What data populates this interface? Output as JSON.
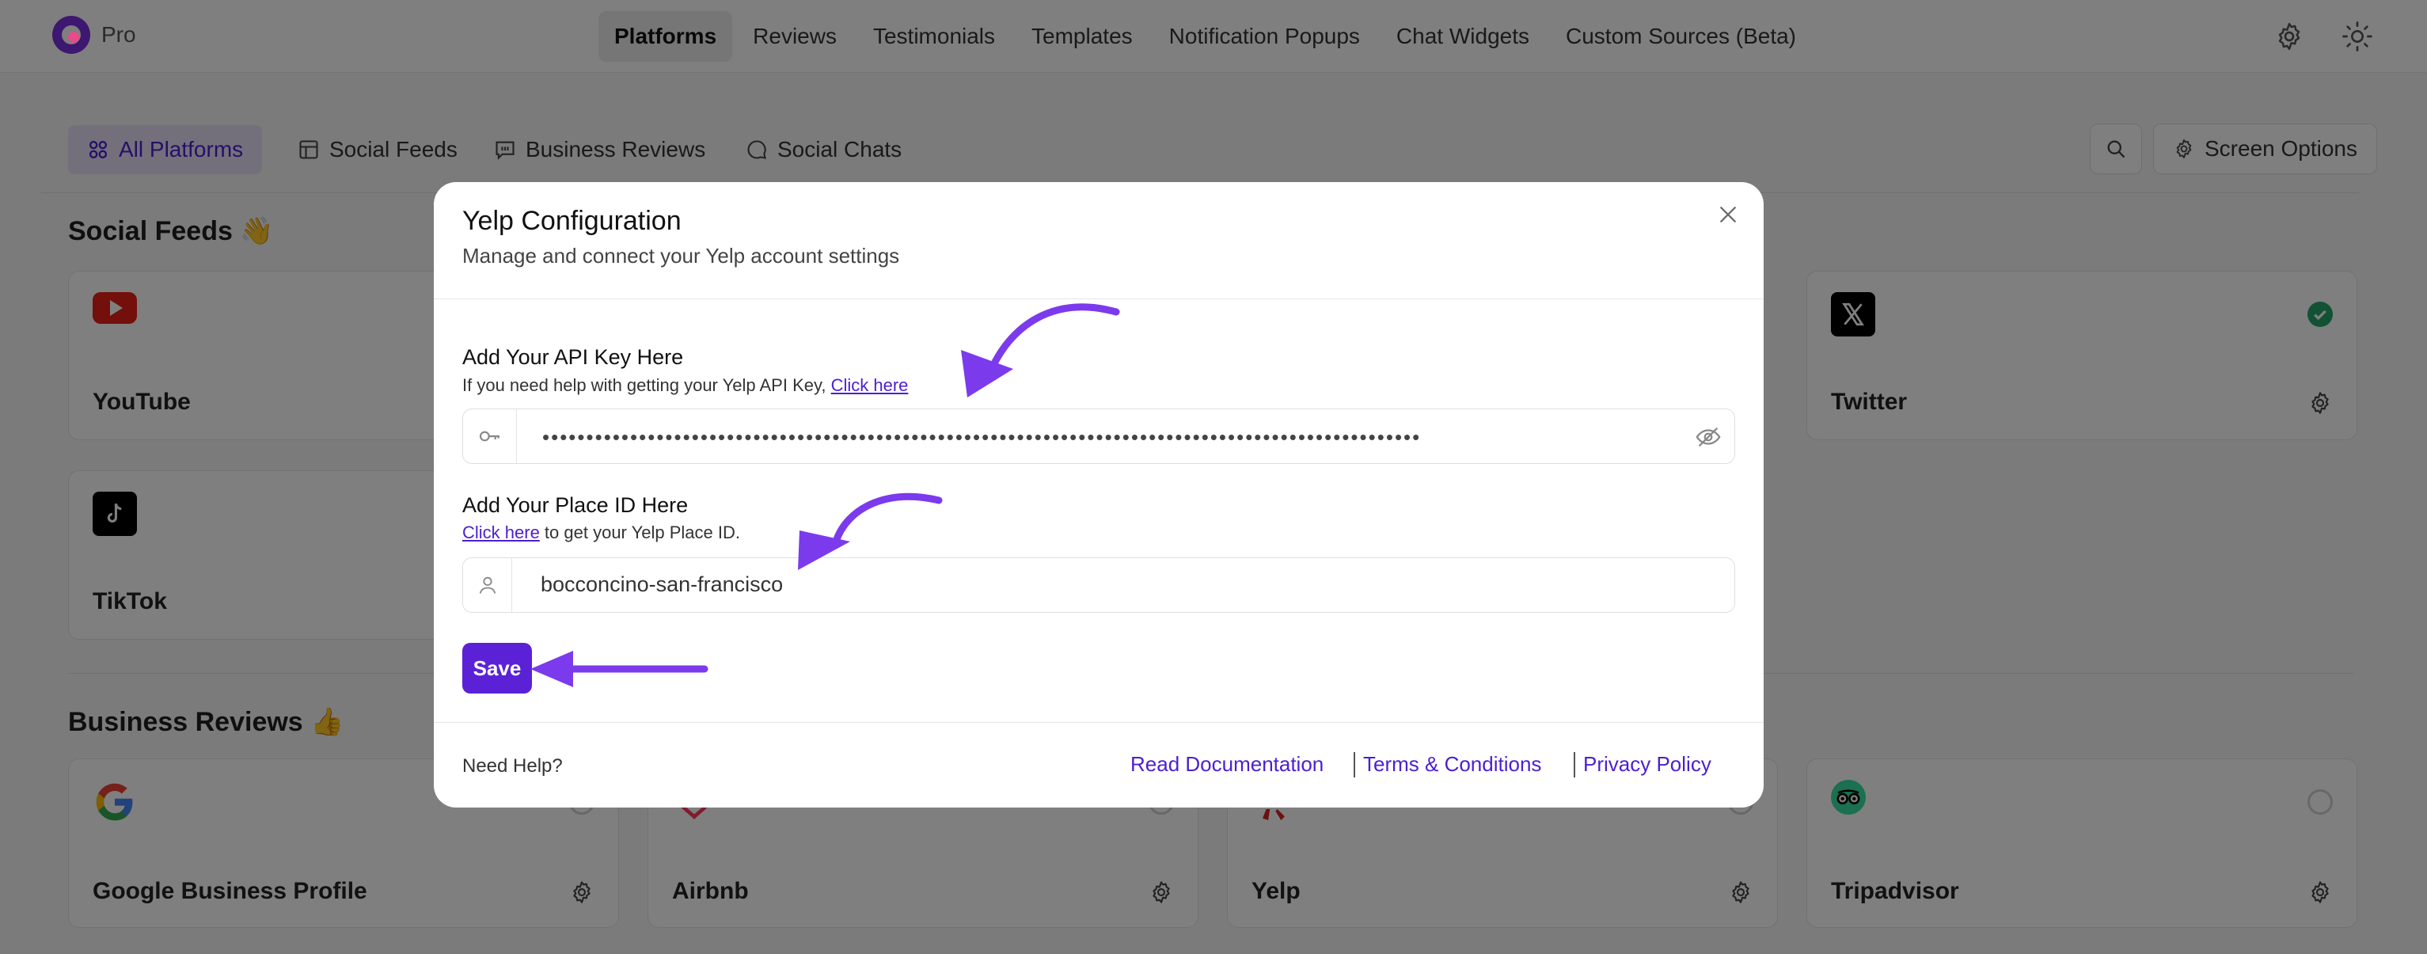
{
  "brand": "Pro",
  "nav": [
    "Platforms",
    "Reviews",
    "Testimonials",
    "Templates",
    "Notification Popups",
    "Chat Widgets",
    "Custom Sources (Beta)"
  ],
  "tabs": [
    "All Platforms",
    "Social Feeds",
    "Business Reviews",
    "Social Chats"
  ],
  "screen_options": "Screen Options",
  "sections": {
    "social_feeds": "Social Feeds 👋",
    "business_reviews": "Business Reviews 👍"
  },
  "cards": {
    "youtube": "YouTube",
    "twitter": "Twitter",
    "tiktok": "TikTok",
    "google": "Google Business Profile",
    "airbnb": "Airbnb",
    "yelp": "Yelp",
    "tripadvisor": "Tripadvisor"
  },
  "modal": {
    "title": "Yelp Configuration",
    "subtitle": "Manage and connect your Yelp account settings",
    "api": {
      "label": "Add Your API Key Here",
      "help_prefix": "If you need help with getting your Yelp API Key, ",
      "help_link": "Click here",
      "value_masked": "••••••••••••••••••••••••••••••••••••••••••••••••••••••••••••••••••••••••••••••••••••••••••••••••••••"
    },
    "place": {
      "label": "Add Your Place ID Here",
      "help_link": "Click here",
      "help_suffix": " to get your Yelp Place ID.",
      "value": "bocconcino-san-francisco"
    },
    "save": "Save",
    "need_help": "Need Help?",
    "links": [
      "Read Documentation",
      "Terms & Conditions",
      "Privacy Policy"
    ]
  },
  "colors": {
    "accent": "#5b21d6",
    "arrow": "#7c3aed",
    "link": "#4c1fd0"
  },
  "icons": [
    "logo-icon",
    "settings-icon",
    "sun-icon",
    "all-platforms-icon",
    "social-feeds-icon",
    "business-reviews-icon",
    "social-chats-icon",
    "search-icon",
    "gear-icon",
    "close-icon",
    "key-icon",
    "eye-off-icon",
    "user-icon"
  ]
}
